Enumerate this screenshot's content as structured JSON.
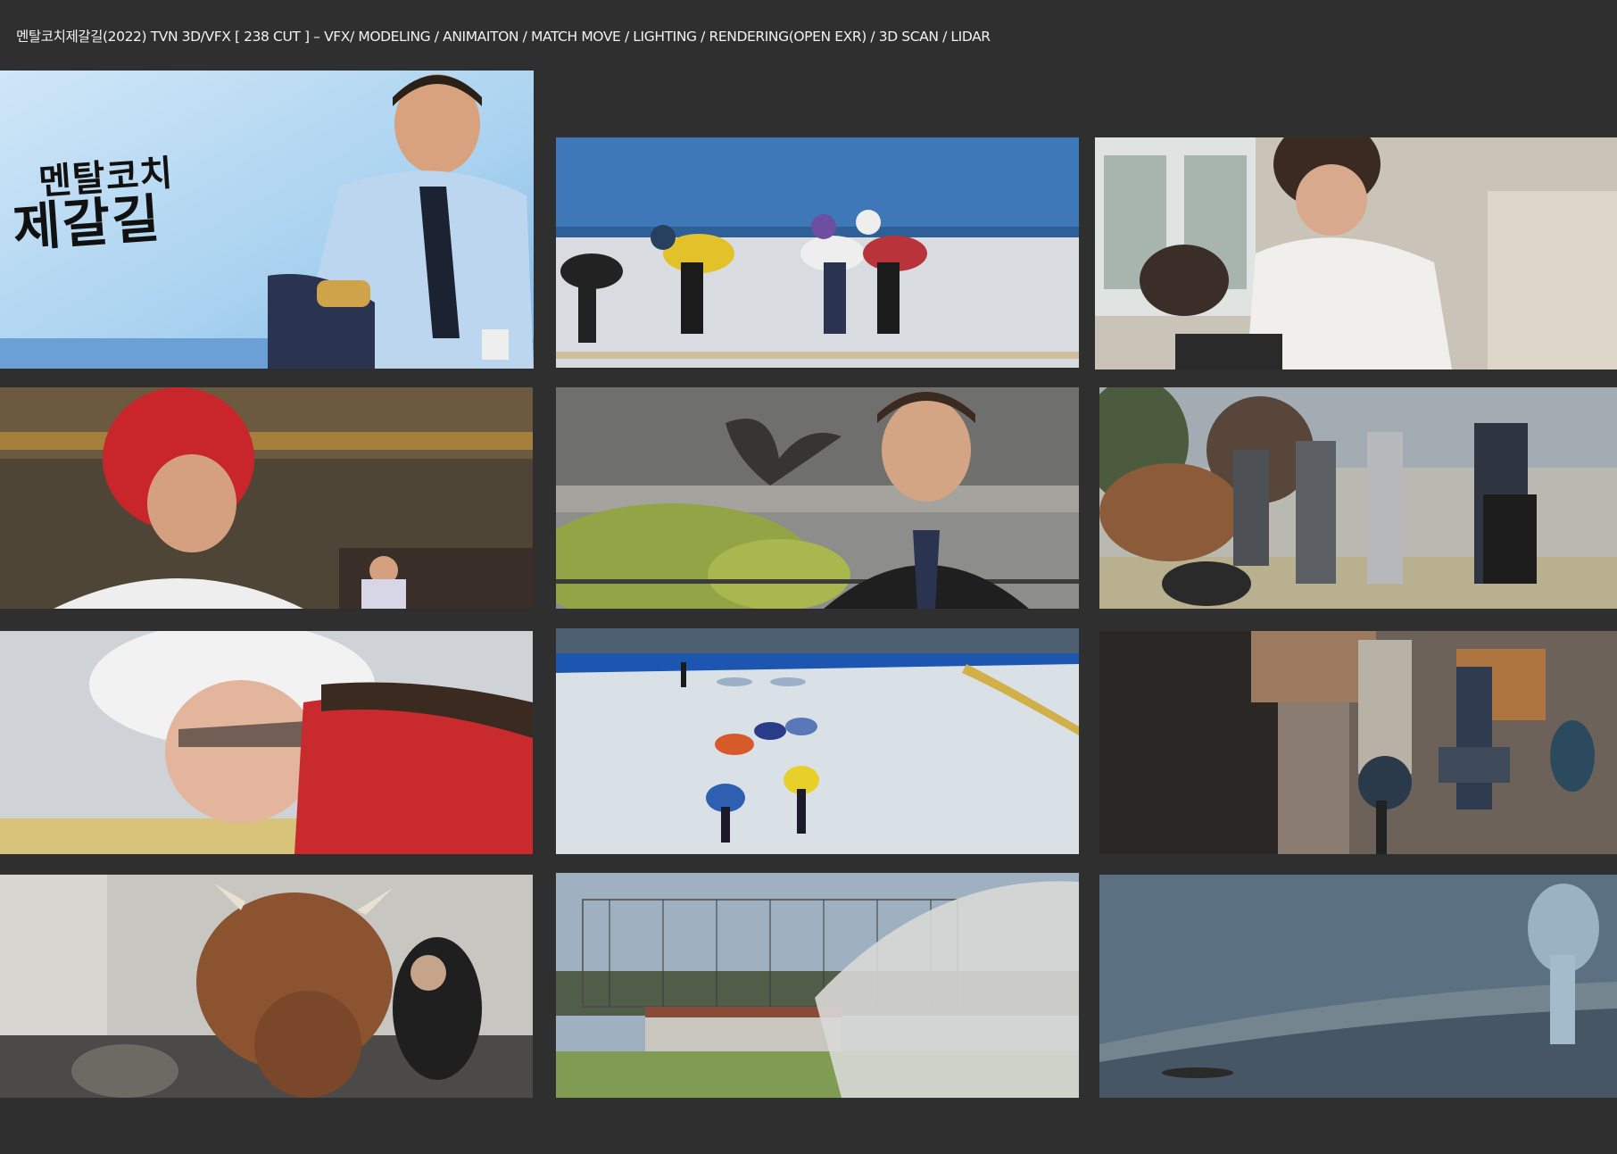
{
  "header": {
    "text": "멘탈코치제갈길(2022) TVN 3D/VFX [ 238  CUT ] – VFX/ MODELING / ANIMAITON / MATCH MOVE / LIGHTING / RENDERING(OPEN EXR) / 3D SCAN  / LIDAR"
  },
  "poster": {
    "title_line1": "멘탈코치",
    "title_line2": "제갈길"
  },
  "frames": [
    {
      "id": "poster",
      "subject": "poster-man-smiling"
    },
    {
      "id": "skaters-rink",
      "subject": "short-track-skaters"
    },
    {
      "id": "doctor-office",
      "subject": "woman-in-white-coat"
    },
    {
      "id": "taekwondo",
      "subject": "athlete-red-helmet"
    },
    {
      "id": "bird-man",
      "subject": "man-and-bird"
    },
    {
      "id": "bull-chaos",
      "subject": "bull-and-crowd"
    },
    {
      "id": "skater-closeup",
      "subject": "skater-white-helmet"
    },
    {
      "id": "rink-overhead",
      "subject": "rink-skaters-overhead"
    },
    {
      "id": "office-night",
      "subject": "man-in-office"
    },
    {
      "id": "bull-close",
      "subject": "bull-closeup"
    },
    {
      "id": "stadium-net",
      "subject": "stadium-netting"
    },
    {
      "id": "night-street",
      "subject": "night-street-man"
    }
  ],
  "colors": {
    "background": "#2f2f2f",
    "header_text": "#f2f2f2"
  }
}
